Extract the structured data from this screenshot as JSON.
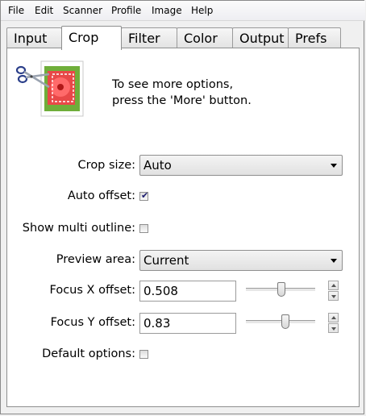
{
  "menubar": {
    "items": [
      "File",
      "Edit",
      "Scanner",
      "Profile",
      "Image",
      "Help"
    ]
  },
  "tabs": [
    {
      "label": "Input",
      "active": false
    },
    {
      "label": "Crop",
      "active": true
    },
    {
      "label": "Filter",
      "active": false
    },
    {
      "label": "Color",
      "active": false
    },
    {
      "label": "Output",
      "active": false
    },
    {
      "label": "Prefs",
      "active": false
    }
  ],
  "crop": {
    "icon": "crop-scissors-icon",
    "hint_line1": "To see more options,",
    "hint_line2": "press the 'More' button.",
    "crop_size": {
      "label": "Crop size:",
      "value": "Auto"
    },
    "auto_offset": {
      "label": "Auto offset:",
      "checked": true
    },
    "show_multi_outline": {
      "label": "Show multi outline:",
      "checked": false
    },
    "preview_area": {
      "label": "Preview area:",
      "value": "Current"
    },
    "focus_x": {
      "label": "Focus X offset:",
      "value": "0.508",
      "level": 0.508
    },
    "focus_y": {
      "label": "Focus Y offset:",
      "value": "0.83",
      "level": 0.58
    },
    "default_options": {
      "label": "Default options:",
      "checked": false
    }
  }
}
